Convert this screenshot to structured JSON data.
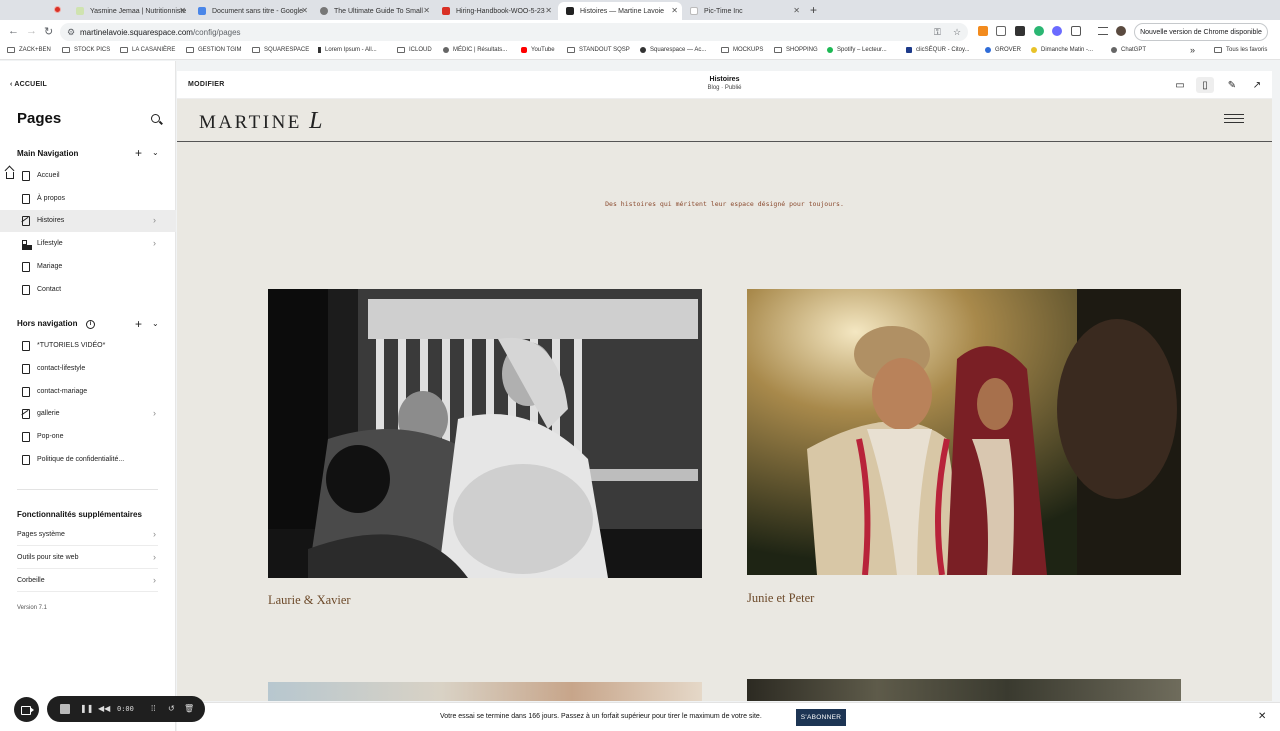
{
  "browser": {
    "tabs": [
      {
        "title": "Yasmine Jemaa | Nutritionniste"
      },
      {
        "title": "Document sans titre - Google"
      },
      {
        "title": "The Ultimate Guide To Small"
      },
      {
        "title": "Hiring-Handbook-WOO-5-23"
      },
      {
        "title": "Histoires — Martine Lavoie"
      },
      {
        "title": "Pic-Time Inc"
      }
    ],
    "url_host": "martinelavoie.squarespace.com",
    "url_path": "/config/pages",
    "update_label": "Nouvelle version de Chrome disponible",
    "bookmarks": [
      "ZACK+BEN",
      "STOCK PICS",
      "LA CASANIÈRE",
      "GESTION TGIM",
      "SQUARESPACE",
      "Lorem Ipsum - All...",
      "ICLOUD",
      "MÉDIC | Résultats...",
      "YouTube",
      "STANDOUT SQSP",
      "Squarespace — Ac...",
      "MOCKUPS",
      "SHOPPING",
      "Spotify – Lecteur...",
      "clicSÉQUR - Citoy...",
      "GROVER",
      "Dimanche Matin -...",
      "ChatGPT"
    ],
    "all_bookmarks": "Tous les favoris",
    "overflow": "»"
  },
  "sidebar": {
    "back_label": "ACCUEIL",
    "title": "Pages",
    "main_nav_title": "Main Navigation",
    "main_nav": [
      {
        "label": "Accueil"
      },
      {
        "label": "À propos"
      },
      {
        "label": "Histoires"
      },
      {
        "label": "Lifestyle"
      },
      {
        "label": "Mariage"
      },
      {
        "label": "Contact"
      }
    ],
    "not_linked_title": "Hors navigation",
    "not_linked": [
      {
        "label": "*TUTORIELS VIDÉO*"
      },
      {
        "label": "contact-lifestyle"
      },
      {
        "label": "contact-mariage"
      },
      {
        "label": "gallerie"
      },
      {
        "label": "Pop-one"
      },
      {
        "label": "Politique de confidentialité..."
      }
    ],
    "extra_title": "Fonctionnalités supplémentaires",
    "extra_items": [
      {
        "label": "Pages système"
      },
      {
        "label": "Outils pour site web"
      },
      {
        "label": "Corbeille"
      }
    ],
    "version": "Version 7.1"
  },
  "editor": {
    "modify_label": "MODIFIER",
    "page_title": "Histoires",
    "page_meta": "Blog · Publié"
  },
  "site": {
    "logo_text": "MARTINE",
    "logo_script": "L",
    "tagline": "Des histoires qui méritent leur espace désigné pour toujours.",
    "posts": [
      {
        "title": "Laurie & Xavier"
      },
      {
        "title": "Junie et Peter"
      }
    ]
  },
  "trial": {
    "message": "Votre essai se termine dans 166 jours. Passez à un forfait supérieur pour tirer le maximum de votre site.",
    "button": "S'ABONNER"
  },
  "recorder": {
    "time": "0:00"
  }
}
